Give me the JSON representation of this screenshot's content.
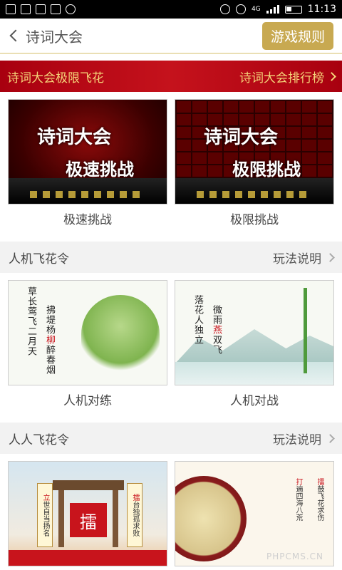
{
  "status_bar": {
    "left_icons": [
      "app-icon",
      "sim-icon",
      "image-icon",
      "sd-icon",
      "message-icon"
    ],
    "network": "4G",
    "time": "11:13"
  },
  "nav": {
    "title": "诗词大会",
    "rules_button": "游戏规则"
  },
  "banner": {
    "left": "诗词大会极限飞花",
    "right": "诗词大会排行榜"
  },
  "contest": {
    "cards": [
      {
        "label": "极速挑战",
        "art_title": "诗词大会",
        "art_sub": "极速挑战"
      },
      {
        "label": "极限挑战",
        "art_title": "诗词大会",
        "art_sub": "极限挑战"
      }
    ]
  },
  "section_ai": {
    "title": "人机飞花令",
    "link": "玩法说明",
    "cards": [
      {
        "label": "人机对练",
        "poem_a": "草长莺飞二月天",
        "poem_b_pre": "拂堤杨",
        "poem_b_hl": "柳",
        "poem_b_post": "醉春烟"
      },
      {
        "label": "人机对战",
        "poem_a": "落花人独立",
        "poem_b_pre": "微雨",
        "poem_b_hl": "燕",
        "poem_b_post": "双飞"
      }
    ]
  },
  "section_pvp": {
    "title": "人人飞花令",
    "link": "玩法说明",
    "cards": [
      {
        "sign": "擂",
        "scroll_left_hl": "立",
        "scroll_left": "世自当扬名",
        "scroll_right_hl": "擂",
        "scroll_right": "台独孤求败"
      },
      {
        "scroll_a_hl": "擂",
        "scroll_a": "鼓飞花求伤",
        "scroll_b_hl": "打",
        "scroll_b": "遍四海八荒",
        "watermark": "PHPCMS.CN"
      }
    ]
  },
  "colors": {
    "gold": "#c8a951",
    "banner_red": "#c5121c",
    "banner_text": "#f5d479"
  }
}
